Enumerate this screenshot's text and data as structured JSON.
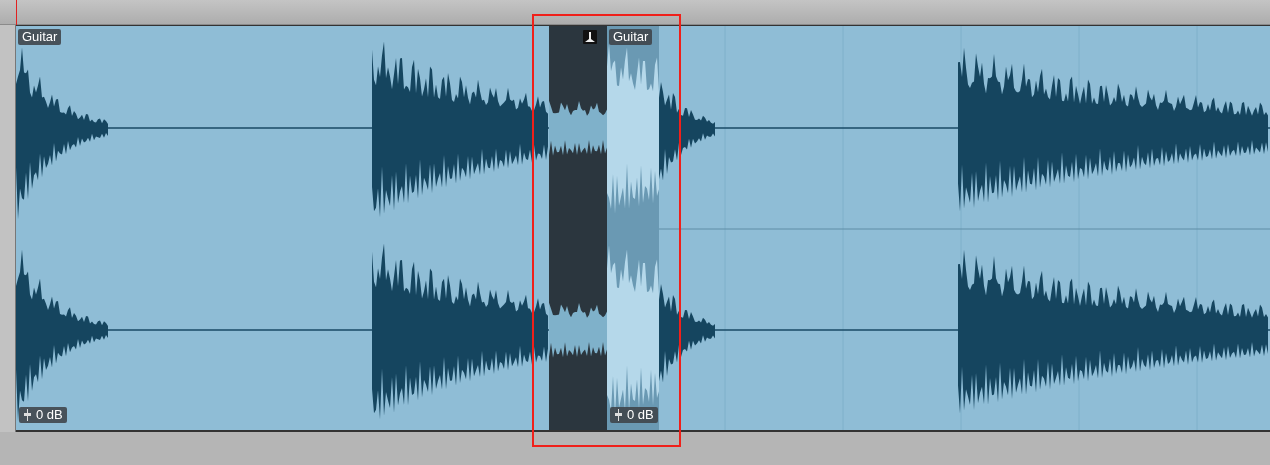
{
  "track": {
    "clips": [
      {
        "kind": "audio",
        "label": "Guitar",
        "gain": "0 dB",
        "selected": false
      },
      {
        "kind": "crossfade",
        "fade_icon": true
      },
      {
        "kind": "audio",
        "label": "Guitar",
        "gain": "0 dB",
        "selected": true
      }
    ]
  },
  "annotation": {
    "kind": "rectangle"
  }
}
